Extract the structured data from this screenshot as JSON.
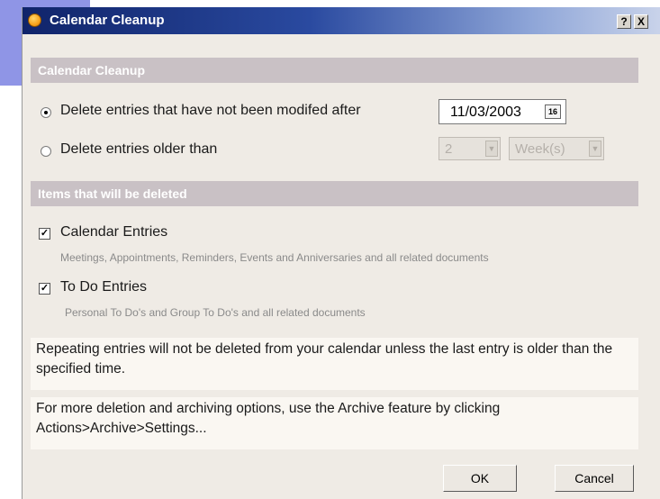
{
  "window": {
    "title": "Calendar Cleanup",
    "help_btn": "?",
    "close_btn": "X"
  },
  "cleanup": {
    "header": "Calendar Cleanup",
    "option_modified": "Delete entries that have not been modifed after",
    "date_value": "11/03/2003",
    "calendar_icon_text": "16",
    "option_older": "Delete entries older than",
    "older_count": "2",
    "older_unit": "Week(s)"
  },
  "items": {
    "header": "Items that will be deleted",
    "calendar_label": "Calendar Entries",
    "calendar_desc": "Meetings, Appointments, Reminders, Events and Anniversaries and all related documents",
    "todo_label": "To Do Entries",
    "todo_desc": "Personal To Do's and Group To Do's and all related documents"
  },
  "notes": {
    "repeating": "Repeating entries will not be deleted from your calendar unless the last entry is older than the specified time.",
    "archive": "For more deletion and archiving options, use the Archive feature by clicking Actions>Archive>Settings..."
  },
  "buttons": {
    "ok": "OK",
    "cancel": "Cancel"
  },
  "colors": {
    "accent": "#10246a",
    "section_header": "#c9c1c5",
    "dialog_bg": "#efebe5"
  },
  "state": {
    "selected_option": "modified",
    "calendar_checked": true,
    "todo_checked": true
  }
}
